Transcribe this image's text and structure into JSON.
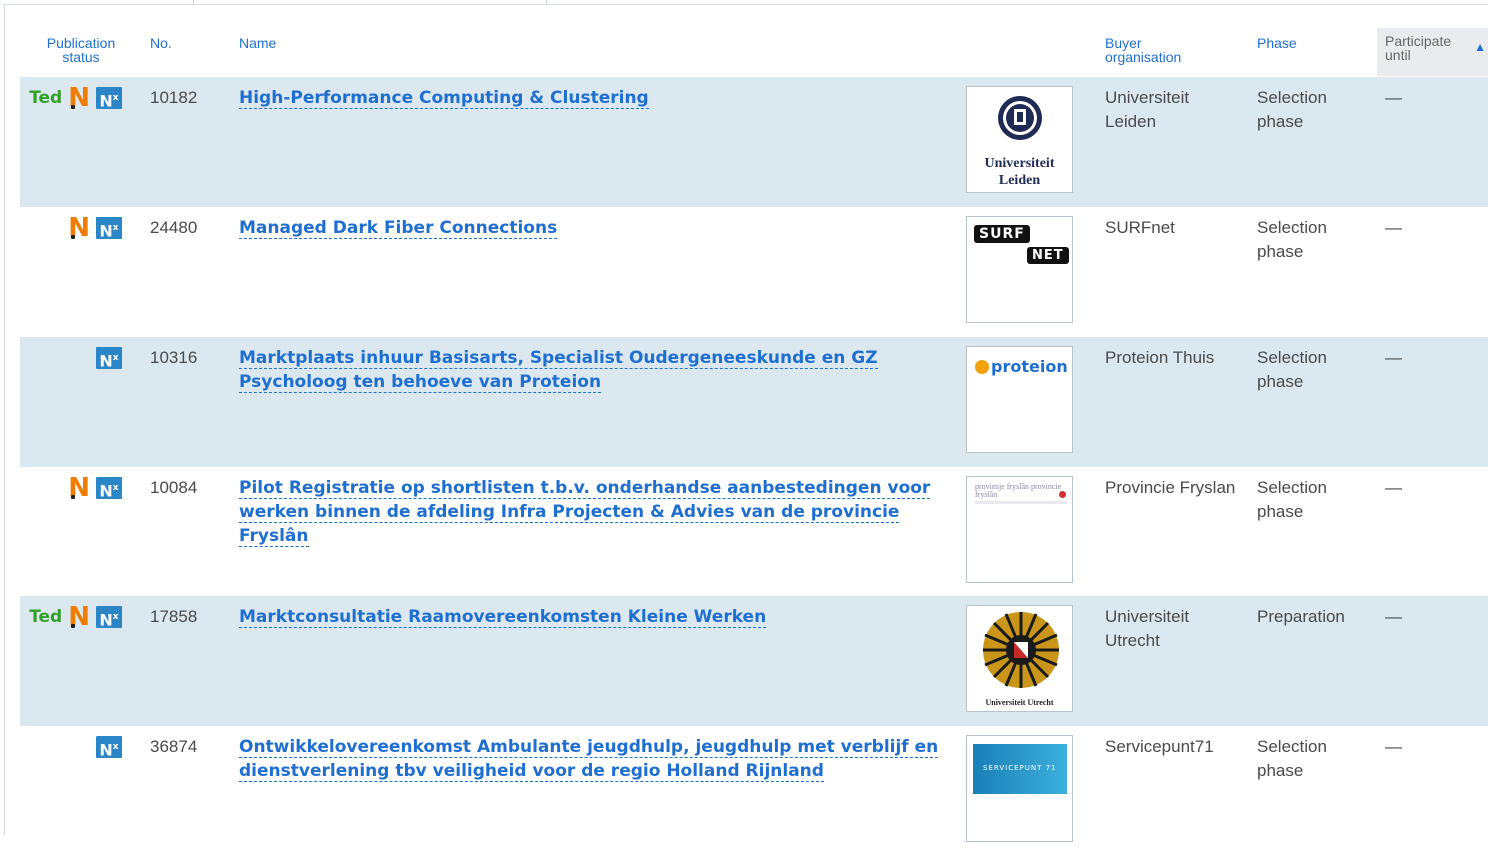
{
  "header": {
    "publication_status": "Publication status",
    "no": "No.",
    "name": "Name",
    "buyer": "Buyer organisation",
    "phase": "Phase",
    "participate_until": "Participate until"
  },
  "rows": [
    {
      "ted": "Ted",
      "number": "10182",
      "name": "High-Performance Computing & Clustering",
      "logo": "Universiteit Leiden",
      "buyer": "Universiteit Leiden",
      "phase": "Selection phase",
      "until": "—"
    },
    {
      "ted": "",
      "number": "24480",
      "name": "Managed Dark Fiber Connections",
      "logo_surf": "SURF",
      "logo_net": "NET",
      "buyer": "SURFnet",
      "phase": "Selection phase",
      "until": "—"
    },
    {
      "ted": "",
      "number": "10316",
      "name": "Marktplaats inhuur Basisarts, Specialist Oudergeneeskunde en GZ Psycholoog ten behoeve van Proteion",
      "logo": "proteion",
      "buyer": "Proteion Thuis",
      "phase": "Selection phase",
      "until": "—"
    },
    {
      "ted": "",
      "number": "10084",
      "name": "Pilot Registratie op shortlisten t.b.v. onderhandse aanbestedingen voor werken binnen de afdeling Infra Projecten & Advies van de provincie Fryslân",
      "logo": "provinsje fryslân provincie fryslân",
      "buyer": "Provincie Fryslan",
      "phase": "Selection phase",
      "until": "—"
    },
    {
      "ted": "Ted",
      "number": "17858",
      "name": "Marktconsultatie Raamovereenkomsten Kleine Werken",
      "logo": "Universiteit Utrecht",
      "buyer": "Universiteit Utrecht",
      "phase": "Preparation",
      "until": "—"
    },
    {
      "ted": "",
      "number": "36874",
      "name": "Ontwikkelovereenkomst Ambulante jeugdhulp, jeugdhulp met verblijf en dienstverlening tbv veiligheid voor de regio Holland Rijnland",
      "logo": "SERVICEPUNT 71",
      "buyer": "Servicepunt71",
      "phase": "Selection phase",
      "until": "—"
    }
  ],
  "icons": {
    "n_letter": "N",
    "nx_letter": "N",
    "nx_sup": "x"
  },
  "colors": {
    "link": "#1f6fd1",
    "row_shade": "#dbe8ef",
    "ted_green": "#33a02c",
    "n_orange": "#f07c00",
    "nx_blue": "#2a86c7"
  }
}
